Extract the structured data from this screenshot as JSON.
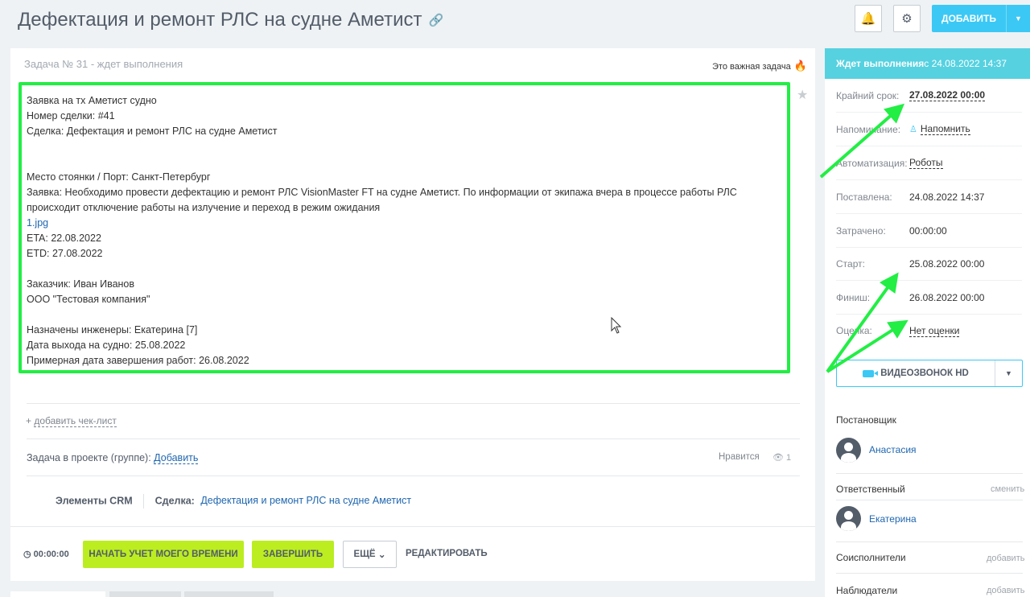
{
  "header": {
    "title": "Дефектация и ремонт РЛС на судне Аметист",
    "add_label": "ДОБАВИТЬ"
  },
  "task": {
    "status": "Задача № 31 - ждет выполнения",
    "important": "Это важная задача",
    "description": {
      "l1": "Заявка на тх Аметист судно",
      "l2": "Номер сделки: #41",
      "l3": "Сделка: Дефектация и ремонт РЛС на судне Аметист",
      "l4": "Место стоянки / Порт: Санкт-Петербург",
      "l5": "Заявка: Необходимо провести дефектацию и ремонт РЛС VisionMaster FT на судне Аметист. По информации от экипажа вчера в процессе работы РЛС происходит отключение работы на излучение и переход в режим ожидания",
      "attachment": "1.jpg",
      "l6": "ETA: 22.08.2022",
      "l7": "ETD: 27.08.2022",
      "l8": "Заказчик: Иван Иванов",
      "l9": "ООО \"Тестовая компания\"",
      "l10": "Назначены инженеры: Екатерина [7]",
      "l11": "Дата выхода на судно: 25.08.2022",
      "l12": "Примерная дата завершения работ: 26.08.2022"
    },
    "add_checklist": "добавить чек-лист",
    "project_label": "Задача в проекте (группе):",
    "project_add": "Добавить",
    "likes": "Нравится",
    "views": "1",
    "crm": {
      "heading": "Элементы CRM",
      "deal_label": "Сделка:",
      "deal_value": "Дефектация и ремонт РЛС на судне Аметист"
    },
    "timer": "00:00:00",
    "start_timer": "НАЧАТЬ УЧЕТ МОЕГО ВРЕМЕНИ",
    "finish": "ЗАВЕРШИТЬ",
    "more": "ЕЩЁ",
    "edit": "РЕДАКТИРОВАТЬ"
  },
  "sidebar": {
    "status_bold": "Ждет выполнения",
    "status_rest": " с 24.08.2022 14:37",
    "rows": {
      "deadline_k": "Крайний срок:",
      "deadline_v": "27.08.2022 00:00",
      "reminder_k": "Напоминание:",
      "reminder_v": "Напомнить",
      "automation_k": "Автоматизация:",
      "automation_v": "Роботы",
      "created_k": "Поставлена:",
      "created_v": "24.08.2022 14:37",
      "spent_k": "Затрачено:",
      "spent_v": "00:00:00",
      "start_k": "Старт:",
      "start_v": "25.08.2022 00:00",
      "finish_k": "Финиш:",
      "finish_v": "26.08.2022 00:00",
      "rating_k": "Оценка:",
      "rating_v": "Нет оценки"
    },
    "video_call": "ВИДЕОЗВОНОК HD",
    "creator_label": "Постановщик",
    "creator_name": "Анастасия",
    "responsible_label": "Ответственный",
    "responsible_change": "сменить",
    "responsible_name": "Екатерина",
    "coexecutors_label": "Соисполнители",
    "coexecutors_add": "добавить",
    "observers_label": "Наблюдатели",
    "observers_add": "добавить"
  },
  "colors": {
    "accent": "#3bc8f5",
    "green_button": "#bbed21",
    "highlight": "#22ee44",
    "status_header": "#56d1e0"
  }
}
